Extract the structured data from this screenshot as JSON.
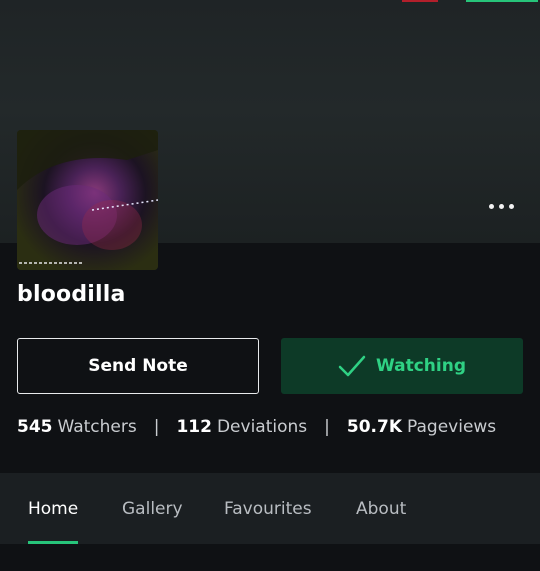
{
  "profile": {
    "username": "bloodilla",
    "avatar_alt": "",
    "menu_icon": "more-horizontal-icon"
  },
  "actions": {
    "send_note_label": "Send Note",
    "watching_label": "Watching",
    "watching_icon": "checkmark-icon"
  },
  "stats": {
    "watchers_count": "545",
    "watchers_label": "Watchers",
    "deviations_count": "112",
    "deviations_label": "Deviations",
    "pageviews_count": "50.7K",
    "pageviews_label": "Pageviews",
    "separator": "|"
  },
  "tabs": [
    {
      "label": "Home",
      "active": true
    },
    {
      "label": "Gallery",
      "active": false
    },
    {
      "label": "Favourites",
      "active": false
    },
    {
      "label": "About",
      "active": false
    }
  ],
  "colors": {
    "accent": "#27c47a",
    "watch_bg": "#0d3a27",
    "background": "#0f1114"
  }
}
